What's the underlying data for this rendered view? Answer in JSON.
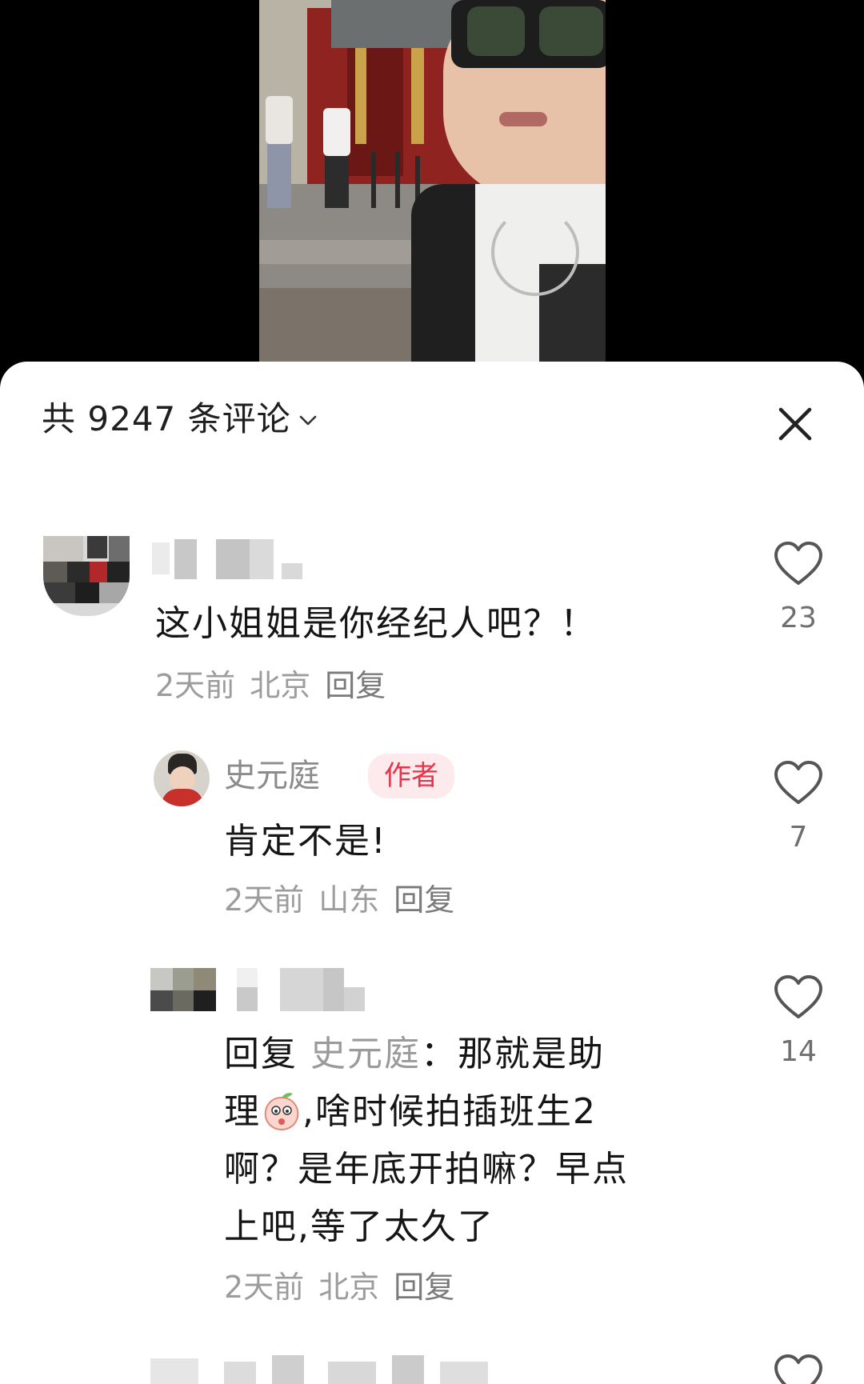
{
  "header": {
    "total_prefix": "共",
    "total_count": "9247",
    "total_suffix": "条评论"
  },
  "icons": {
    "chevron": "chevron-down-icon",
    "close": "close-icon",
    "like": "heart-outline-icon",
    "emoji": "peach-sticker-emoji"
  },
  "colors": {
    "author_tag_text": "#e8334a",
    "author_tag_bg": "#fdeaec",
    "meta": "#9c9c9c"
  },
  "comments": [
    {
      "text": "这小姐姐是你经纪人吧？！",
      "time": "2天前",
      "location": "北京",
      "reply_label": "回复",
      "likes": "23"
    },
    {
      "username": "史元庭",
      "author_tag": "作者",
      "text": "肯定不是!",
      "time": "2天前",
      "location": "山东",
      "reply_label": "回复",
      "likes": "7"
    },
    {
      "reply_prefix": "回复",
      "reply_to": "史元庭",
      "text_line1": "：那就是助",
      "text_line1b": "理",
      "text_line2": ",啥时候拍插班生2",
      "text_line3": "啊？是年底开拍嘛？早点",
      "text_line4": "上吧,等了太久了",
      "time": "2天前",
      "location": "北京",
      "reply_label": "回复",
      "likes": "14"
    }
  ]
}
